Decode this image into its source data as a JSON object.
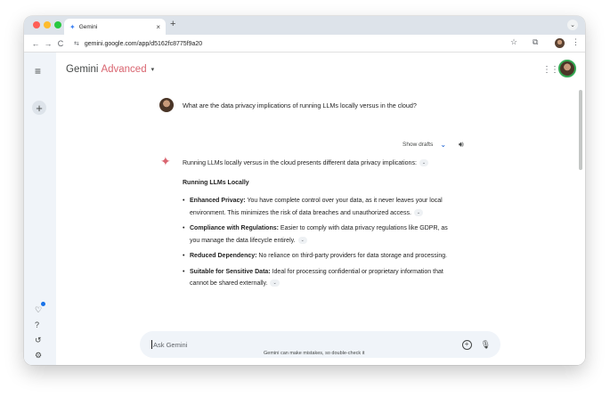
{
  "browser": {
    "tab_title": "Gemini",
    "tab_favicon": "gemini-spark-icon",
    "tab_close": "×",
    "new_tab": "+",
    "tab_menu": "⌄",
    "url": "gemini.google.com/app/d5162fc8775f9a20",
    "nav": {
      "back": "←",
      "forward": "→",
      "reload": "C"
    }
  },
  "app": {
    "brand": "Gemini",
    "brand_tier": "Advanced",
    "brand_caret": "▾",
    "new_chat_label": "+",
    "menu_icon": "≡",
    "accent_color": "#d96570"
  },
  "conversation": {
    "user_prompt": "What are the data privacy implications of running LLMs locally versus in the cloud?",
    "show_drafts_label": "Show drafts",
    "show_drafts_chevron": "⌄",
    "response": {
      "intro": "Running LLMs locally versus in the cloud presents different data privacy implications:",
      "chip": "⌄",
      "heading": "Running LLMs Locally",
      "bullets": [
        {
          "title": "Enhanced Privacy:",
          "text": " You have complete control over your data, as it never leaves your local environment. This minimizes the risk of data breaches and unauthorized access."
        },
        {
          "title": "Compliance with Regulations:",
          "text": " Easier to comply with data privacy regulations like GDPR, as you manage the data lifecycle entirely."
        },
        {
          "title": "Reduced Dependency:",
          "text": " No reliance on third-party providers for data storage and processing."
        },
        {
          "title": "Suitable for Sensitive Data:",
          "text": " Ideal for processing confidential or proprietary information that cannot be shared externally."
        }
      ]
    }
  },
  "input": {
    "placeholder": "Ask Gemini"
  },
  "disclaimer": "Gemini can make mistakes, so double-check it"
}
